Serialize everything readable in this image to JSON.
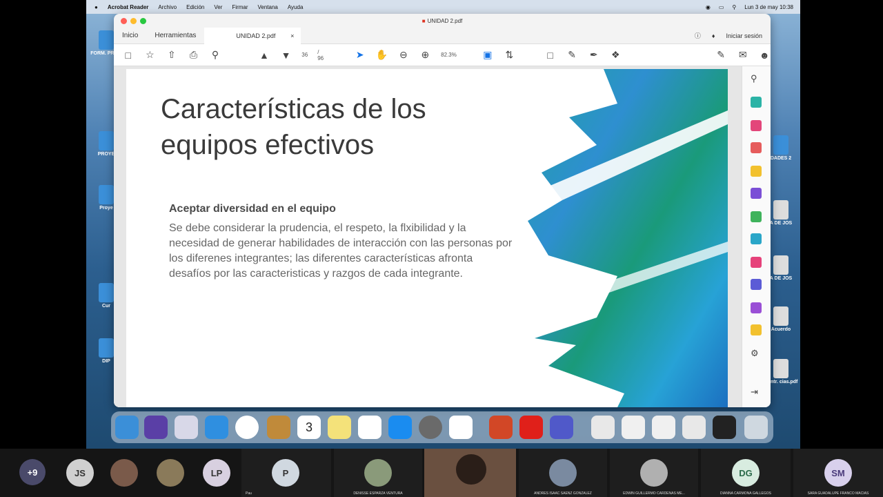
{
  "menubar": {
    "app_name": "Acrobat Reader",
    "items": [
      "Archivo",
      "Edición",
      "Ver",
      "Firmar",
      "Ventana",
      "Ayuda"
    ],
    "datetime": "Lun 3 de may 10:38"
  },
  "desktop_icons": [
    "FORM. PREVI",
    "PROYE",
    "Proye",
    "Cur",
    "DIP",
    "DADES 2",
    "A DE JOS",
    "A DE JOS",
    "Acuerdo",
    "Contr. cias.pdf"
  ],
  "window": {
    "title": "UNIDAD 2.pdf",
    "tabs": {
      "home": "Inicio",
      "tools": "Herramientas",
      "doc": "UNIDAD 2.pdf"
    },
    "signin": "Iniciar sesión",
    "page_current": "36",
    "page_total": "/ 96",
    "zoom": "82.3%"
  },
  "slide": {
    "title": "Características de los equipos efectivos",
    "heading": "Aceptar diversidad en el equipo",
    "body": "Se debe considerar la prudencia, el respeto, la flxibilidad y la necesidad de generar habilidades de interacción con las personas por los diferenes integrantes; las diferentes características afronta desafíos por las caracteristicas y razgos de cada integrante."
  },
  "calendar_day": "3",
  "participants": [
    {
      "initials": "+9",
      "name": "",
      "color": "#4a4a6a"
    },
    {
      "initials": "JS",
      "name": "",
      "color": "#d0d0d0"
    },
    {
      "initials": "",
      "name": "",
      "color": "#7a5a4a"
    },
    {
      "initials": "",
      "name": "",
      "color": "#8a7a5a"
    },
    {
      "initials": "LP",
      "name": "",
      "color": "#d8d0e0"
    },
    {
      "initials": "P",
      "name": "Pau",
      "color": "#d0d8e0"
    },
    {
      "initials": "",
      "name": "DENISSE ESPARZA VENTURA",
      "color": "#8a9a7a"
    },
    {
      "initials": "",
      "name": "",
      "color": "#6a5040"
    },
    {
      "initials": "",
      "name": "ANDRES ISAAC SAENZ GONZALEZ",
      "color": "#7a8aa0"
    },
    {
      "initials": "",
      "name": "EDWIN GUILLERMO CARDENAS ME...",
      "color": "#b0b0b0"
    },
    {
      "initials": "DG",
      "name": "DIANNA CARMONA GALLEGOS",
      "color": "#d8ece0"
    },
    {
      "initials": "SM",
      "name": "SARA GUADALUPE FRANCO MACIAS",
      "color": "#d8d0ec"
    }
  ]
}
